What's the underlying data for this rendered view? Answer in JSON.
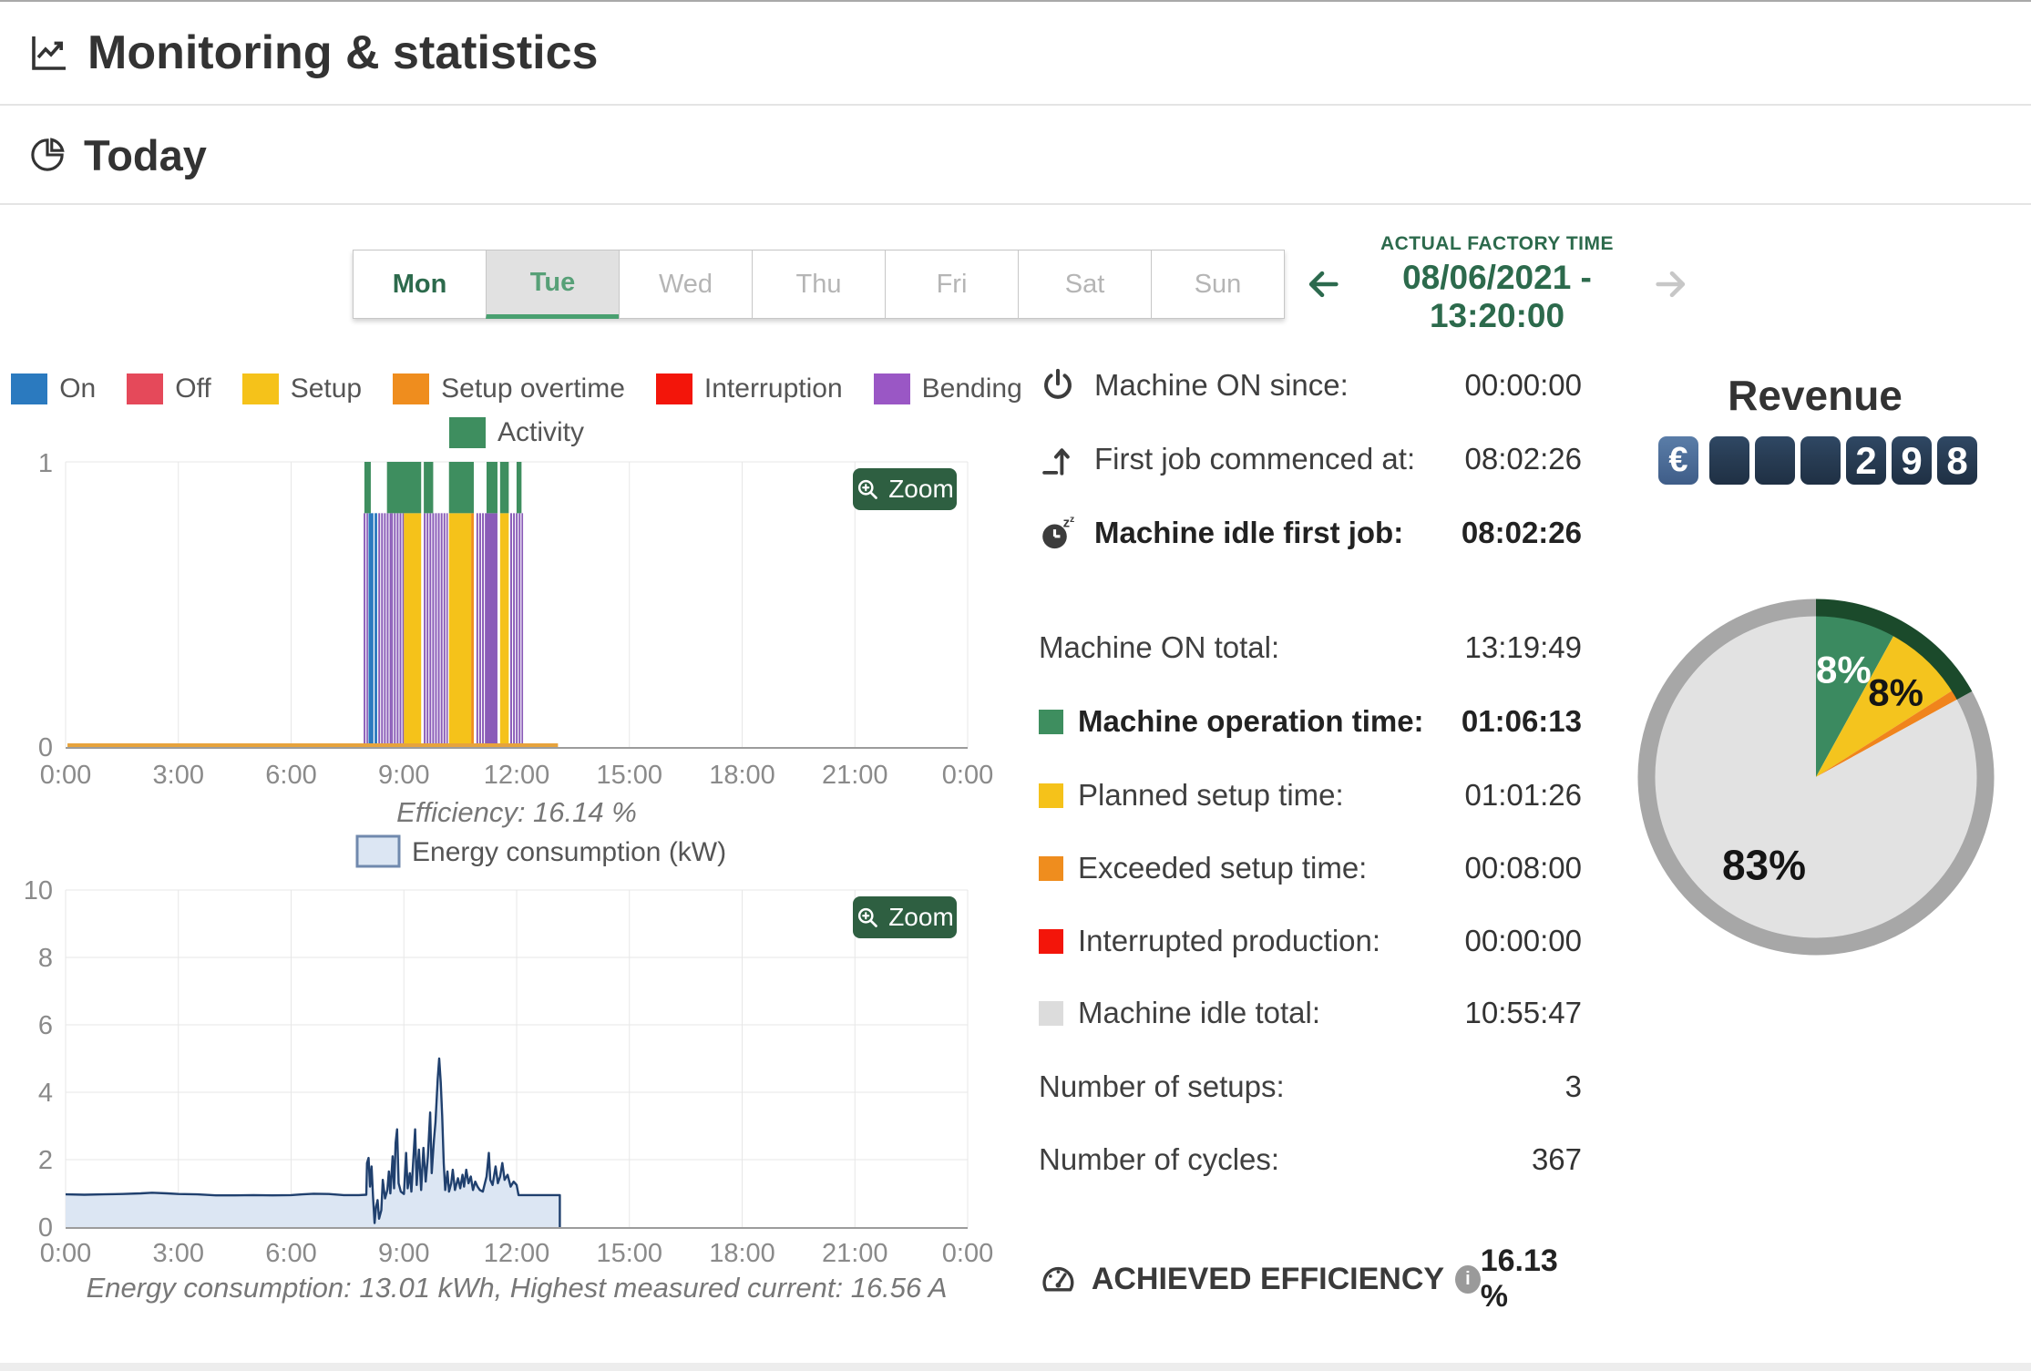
{
  "header": {
    "title": "Monitoring & statistics"
  },
  "section": {
    "title": "Today"
  },
  "day_tabs": [
    "Mon",
    "Tue",
    "Wed",
    "Thu",
    "Fri",
    "Sat",
    "Sun"
  ],
  "factory_time": {
    "label": "ACTUAL FACTORY TIME",
    "value": "08/06/2021 - 13:20:00"
  },
  "controls": {
    "zoom_label": "Zoom"
  },
  "stats": {
    "rows": [
      {
        "icon": "power-icon",
        "label": "Machine ON since:",
        "value": "00:00:00"
      },
      {
        "icon": "first-job-icon",
        "label": "First job commenced at:",
        "value": "08:02:26"
      },
      {
        "icon": "idle-clock-icon",
        "label": "Machine idle first job:",
        "value": "08:02:26",
        "bold": true
      },
      {
        "label": "Machine ON total:",
        "value": "13:19:49"
      },
      {
        "swatch": "#3e8e5f",
        "label": "Machine operation time:",
        "value": "01:06:13",
        "bold": true
      },
      {
        "swatch": "#f5c21a",
        "label": "Planned setup time:",
        "value": "01:01:26"
      },
      {
        "swatch": "#ef8d1e",
        "label": "Exceeded setup time:",
        "value": "00:08:00"
      },
      {
        "swatch": "#f3150a",
        "label": "Interrupted production:",
        "value": "00:00:00"
      },
      {
        "swatch": "#dcdcdc",
        "label": "Machine idle total:",
        "value": "10:55:47"
      },
      {
        "label": "Number of setups:",
        "value": "3"
      },
      {
        "label": "Number of cycles:",
        "value": "367"
      }
    ],
    "efficiency": {
      "label": "ACHIEVED EFFICIENCY",
      "value": "16.13 %"
    }
  },
  "revenue": {
    "title": "Revenue",
    "currency": "€",
    "tiles": [
      "",
      "",
      "",
      "2",
      "9",
      "8"
    ]
  },
  "chart_data": [
    {
      "type": "bar",
      "title": "Machine state timeline",
      "x_ticks": [
        "0:00",
        "3:00",
        "6:00",
        "9:00",
        "12:00",
        "15:00",
        "18:00",
        "21:00",
        "0:00"
      ],
      "x_range_hours": [
        0,
        24
      ],
      "ylim": [
        0,
        1
      ],
      "y_ticks": [
        "0",
        "1"
      ],
      "caption": "Efficiency: 16.14 %",
      "legend": [
        {
          "label": "On",
          "color": "#2b7abf"
        },
        {
          "label": "Off",
          "color": "#e5495a"
        },
        {
          "label": "Setup",
          "color": "#f5c21a"
        },
        {
          "label": "Setup overtime",
          "color": "#ef8d1e"
        },
        {
          "label": "Interruption",
          "color": "#f3150a"
        },
        {
          "label": "Bending",
          "color": "#9a57c5"
        }
      ],
      "legend2": {
        "label": "Activity",
        "color": "#3e8e5f"
      },
      "activity_color": "#3e8e5f",
      "bar_top_fraction": 0.82,
      "baseline": {
        "color": "#e7a33c",
        "from_h": 0.05,
        "to_h": 13.1
      },
      "segments": [
        {
          "from": 7.93,
          "to": 8.03,
          "color": "#8a5cb8",
          "striped": true
        },
        {
          "from": 8.06,
          "to": 8.19,
          "color": "#2b7abf",
          "striped": false
        },
        {
          "from": 8.22,
          "to": 8.29,
          "color": "#2b7abf",
          "striped": false
        },
        {
          "from": 8.32,
          "to": 8.62,
          "color": "#8a5cb8",
          "striped": true
        },
        {
          "from": 8.66,
          "to": 9.0,
          "color": "#8a5cb8",
          "striped": true
        },
        {
          "from": 9.0,
          "to": 9.46,
          "color": "#f5c21a",
          "striped": false
        },
        {
          "from": 9.53,
          "to": 10.13,
          "color": "#8a5cb8",
          "striped": true
        },
        {
          "from": 10.2,
          "to": 10.79,
          "color": "#f5c21a",
          "striped": false
        },
        {
          "from": 10.79,
          "to": 10.86,
          "color": "#ef8d1e",
          "striped": false
        },
        {
          "from": 10.93,
          "to": 11.2,
          "color": "#8a5cb8",
          "striped": true
        },
        {
          "from": 11.2,
          "to": 11.49,
          "color": "#8a5cb8",
          "striped": false
        },
        {
          "from": 11.56,
          "to": 11.79,
          "color": "#f5c21a",
          "striped": false
        },
        {
          "from": 11.83,
          "to": 12.13,
          "color": "#8a5cb8",
          "striped": true
        }
      ],
      "green_top_ranges": [
        [
          7.95,
          8.12
        ],
        [
          8.55,
          9.46
        ],
        [
          9.53,
          9.78
        ],
        [
          10.2,
          10.86
        ],
        [
          11.2,
          11.49
        ],
        [
          11.56,
          11.79
        ],
        [
          12.0,
          12.13
        ]
      ]
    },
    {
      "type": "area",
      "legend_label": "Energy consumption (kW)",
      "x_ticks": [
        "0:00",
        "3:00",
        "6:00",
        "9:00",
        "12:00",
        "15:00",
        "18:00",
        "21:00",
        "0:00"
      ],
      "ylim": [
        0,
        10
      ],
      "y_ticks": [
        0,
        2,
        4,
        6,
        8,
        10
      ],
      "fill": "#dce6f3",
      "line": "#20406e",
      "caption": "Energy consumption: 13.01 kWh, Highest measured current: 16.56 A",
      "points": [
        [
          0,
          0.97
        ],
        [
          0.5,
          0.96
        ],
        [
          1,
          0.97
        ],
        [
          1.5,
          0.98
        ],
        [
          2,
          1.0
        ],
        [
          2.3,
          1.02
        ],
        [
          2.7,
          1.0
        ],
        [
          3,
          0.98
        ],
        [
          3.5,
          0.97
        ],
        [
          4,
          0.94
        ],
        [
          4.5,
          0.94
        ],
        [
          5,
          0.95
        ],
        [
          5.5,
          0.94
        ],
        [
          6,
          0.95
        ],
        [
          6.3,
          0.97
        ],
        [
          6.6,
          0.99
        ],
        [
          7,
          0.98
        ],
        [
          7.4,
          0.95
        ],
        [
          7.8,
          0.95
        ],
        [
          8.0,
          0.96
        ],
        [
          8.02,
          1.9
        ],
        [
          8.06,
          2.05
        ],
        [
          8.1,
          1.2
        ],
        [
          8.14,
          1.8
        ],
        [
          8.18,
          0.9
        ],
        [
          8.22,
          0.12
        ],
        [
          8.26,
          0.6
        ],
        [
          8.3,
          0.8
        ],
        [
          8.34,
          0.25
        ],
        [
          8.4,
          0.5
        ],
        [
          8.44,
          1.4
        ],
        [
          8.5,
          0.85
        ],
        [
          8.56,
          1.1
        ],
        [
          8.6,
          1.65
        ],
        [
          8.64,
          1.0
        ],
        [
          8.7,
          2.1
        ],
        [
          8.74,
          1.15
        ],
        [
          8.78,
          2.5
        ],
        [
          8.82,
          2.9
        ],
        [
          8.86,
          1.3
        ],
        [
          8.92,
          1.05
        ],
        [
          9.0,
          0.98
        ],
        [
          9.06,
          2.2
        ],
        [
          9.1,
          1.15
        ],
        [
          9.16,
          1.6
        ],
        [
          9.2,
          1.05
        ],
        [
          9.3,
          2.9
        ],
        [
          9.34,
          1.25
        ],
        [
          9.4,
          2.3
        ],
        [
          9.46,
          1.1
        ],
        [
          9.52,
          2.35
        ],
        [
          9.58,
          1.35
        ],
        [
          9.64,
          2.1
        ],
        [
          9.7,
          3.4
        ],
        [
          9.74,
          1.6
        ],
        [
          9.8,
          2.6
        ],
        [
          9.84,
          3.1
        ],
        [
          9.9,
          4.4
        ],
        [
          9.94,
          5.0
        ],
        [
          9.98,
          4.3
        ],
        [
          10.02,
          3.3
        ],
        [
          10.06,
          1.9
        ],
        [
          10.1,
          1.1
        ],
        [
          10.16,
          1.65
        ],
        [
          10.2,
          1.05
        ],
        [
          10.26,
          1.3
        ],
        [
          10.3,
          1.7
        ],
        [
          10.36,
          1.1
        ],
        [
          10.44,
          1.45
        ],
        [
          10.5,
          1.15
        ],
        [
          10.56,
          1.55
        ],
        [
          10.6,
          1.2
        ],
        [
          10.66,
          1.7
        ],
        [
          10.72,
          1.3
        ],
        [
          10.78,
          1.5
        ],
        [
          10.84,
          1.1
        ],
        [
          10.9,
          1.35
        ],
        [
          10.96,
          1.2
        ],
        [
          11.02,
          1.1
        ],
        [
          11.1,
          1.05
        ],
        [
          11.2,
          1.5
        ],
        [
          11.26,
          2.2
        ],
        [
          11.3,
          1.4
        ],
        [
          11.36,
          1.25
        ],
        [
          11.44,
          1.8
        ],
        [
          11.5,
          1.3
        ],
        [
          11.56,
          1.5
        ],
        [
          11.62,
          1.9
        ],
        [
          11.68,
          1.4
        ],
        [
          11.76,
          1.55
        ],
        [
          11.84,
          1.2
        ],
        [
          11.92,
          1.35
        ],
        [
          12.0,
          1.25
        ],
        [
          12.05,
          0.95
        ],
        [
          12.5,
          0.95
        ],
        [
          13.0,
          0.95
        ],
        [
          13.15,
          0.95
        ],
        [
          13.15,
          0
        ]
      ]
    },
    {
      "type": "pie",
      "slices": [
        {
          "label": "8%",
          "value": 8,
          "color": "#3b8a60",
          "label_color": "#ffffff",
          "label_radius": 122,
          "label_size": 42
        },
        {
          "label": "8%",
          "value": 8,
          "color": "#f4c41e",
          "label_color": "#151515",
          "label_radius": 128,
          "label_size": 42
        },
        {
          "label": "",
          "value": 1,
          "color": "#f0841c",
          "label_color": "",
          "label_radius": 0,
          "label_size": 0
        },
        {
          "label": "83%",
          "value": 83,
          "color": "#e2e2e2",
          "label_color": "#151515",
          "label_radius": 112,
          "label_size": 46
        }
      ],
      "ring_color": "#a7a7a7",
      "ring_highlight_color": "#1b4a2b",
      "ring_highlight_pct": 17
    }
  ]
}
